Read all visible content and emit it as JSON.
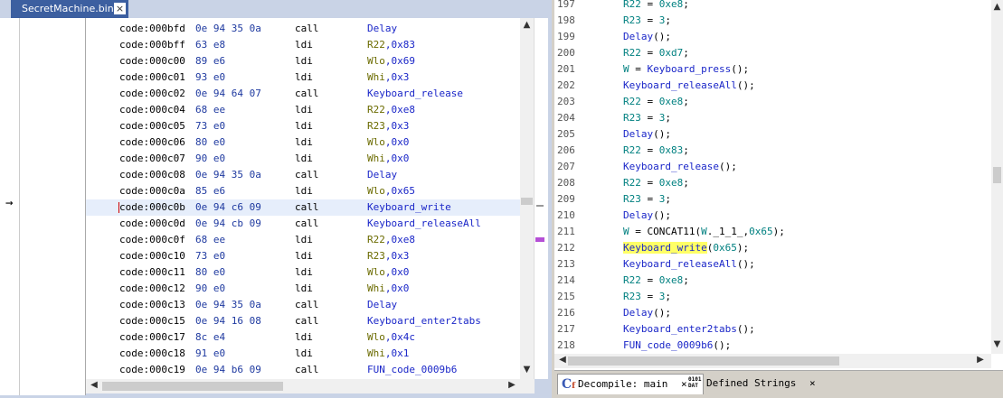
{
  "listing": {
    "tab_label": "SecretMachine.bin",
    "tab_close": "×",
    "arrow": "→",
    "rows": [
      {
        "addr": "code:000bfd",
        "bytes": "0e 94 35 0a",
        "mn": "call",
        "op": "Delay"
      },
      {
        "addr": "code:000bff",
        "bytes": "63 e8",
        "mn": "ldi",
        "op": "R22,0x83"
      },
      {
        "addr": "code:000c00",
        "bytes": "89 e6",
        "mn": "ldi",
        "op": "Wlo,0x69"
      },
      {
        "addr": "code:000c01",
        "bytes": "93 e0",
        "mn": "ldi",
        "op": "Whi,0x3"
      },
      {
        "addr": "code:000c02",
        "bytes": "0e 94 64 07",
        "mn": "call",
        "op": "Keyboard_release"
      },
      {
        "addr": "code:000c04",
        "bytes": "68 ee",
        "mn": "ldi",
        "op": "R22,0xe8"
      },
      {
        "addr": "code:000c05",
        "bytes": "73 e0",
        "mn": "ldi",
        "op": "R23,0x3"
      },
      {
        "addr": "code:000c06",
        "bytes": "80 e0",
        "mn": "ldi",
        "op": "Wlo,0x0"
      },
      {
        "addr": "code:000c07",
        "bytes": "90 e0",
        "mn": "ldi",
        "op": "Whi,0x0"
      },
      {
        "addr": "code:000c08",
        "bytes": "0e 94 35 0a",
        "mn": "call",
        "op": "Delay"
      },
      {
        "addr": "code:000c0a",
        "bytes": "85 e6",
        "mn": "ldi",
        "op": "Wlo,0x65"
      },
      {
        "addr": "code:000c0b",
        "bytes": "0e 94 c6 09",
        "mn": "call",
        "op": "Keyboard_write"
      },
      {
        "addr": "code:000c0d",
        "bytes": "0e 94 cb 09",
        "mn": "call",
        "op": "Keyboard_releaseAll"
      },
      {
        "addr": "code:000c0f",
        "bytes": "68 ee",
        "mn": "ldi",
        "op": "R22,0xe8"
      },
      {
        "addr": "code:000c10",
        "bytes": "73 e0",
        "mn": "ldi",
        "op": "R23,0x3"
      },
      {
        "addr": "code:000c11",
        "bytes": "80 e0",
        "mn": "ldi",
        "op": "Wlo,0x0"
      },
      {
        "addr": "code:000c12",
        "bytes": "90 e0",
        "mn": "ldi",
        "op": "Whi,0x0"
      },
      {
        "addr": "code:000c13",
        "bytes": "0e 94 35 0a",
        "mn": "call",
        "op": "Delay"
      },
      {
        "addr": "code:000c15",
        "bytes": "0e 94 16 08",
        "mn": "call",
        "op": "Keyboard_enter2tabs"
      },
      {
        "addr": "code:000c17",
        "bytes": "8c e4",
        "mn": "ldi",
        "op": "Wlo,0x4c"
      },
      {
        "addr": "code:000c18",
        "bytes": "91 e0",
        "mn": "ldi",
        "op": "Whi,0x1"
      },
      {
        "addr": "code:000c19",
        "bytes": "0e 94 b6 09",
        "mn": "call",
        "op": "FUN_code_0009b6"
      }
    ]
  },
  "decompile": {
    "lines": [
      {
        "n": "197",
        "t": "R22 = 0xe8;"
      },
      {
        "n": "198",
        "t": "R23 = 3;"
      },
      {
        "n": "199",
        "t": "Delay();"
      },
      {
        "n": "200",
        "t": "R22 = 0xd7;"
      },
      {
        "n": "201",
        "t": "W = Keyboard_press();"
      },
      {
        "n": "202",
        "t": "Keyboard_releaseAll();"
      },
      {
        "n": "203",
        "t": "R22 = 0xe8;"
      },
      {
        "n": "204",
        "t": "R23 = 3;"
      },
      {
        "n": "205",
        "t": "Delay();"
      },
      {
        "n": "206",
        "t": "R22 = 0x83;"
      },
      {
        "n": "207",
        "t": "Keyboard_release();"
      },
      {
        "n": "208",
        "t": "R22 = 0xe8;"
      },
      {
        "n": "209",
        "t": "R23 = 3;"
      },
      {
        "n": "210",
        "t": "Delay();"
      },
      {
        "n": "211",
        "t": "W = CONCAT11(W._1_1_,0x65);"
      },
      {
        "n": "212",
        "t": "Keyboard_write(0x65);"
      },
      {
        "n": "213",
        "t": "Keyboard_releaseAll();"
      },
      {
        "n": "214",
        "t": "R22 = 0xe8;"
      },
      {
        "n": "215",
        "t": "R23 = 3;"
      },
      {
        "n": "216",
        "t": "Delay();"
      },
      {
        "n": "217",
        "t": "Keyboard_enter2tabs();"
      },
      {
        "n": "218",
        "t": "FUN_code_0009b6();"
      }
    ]
  },
  "bottom_tabs": [
    {
      "label": "Decompile: main",
      "close": "×",
      "icon": "decompile-icon"
    },
    {
      "label": "Defined Strings",
      "close": "×",
      "icon": "strings-icon",
      "icon_text_top": "0101",
      "icon_text_bottom": "DAT"
    }
  ],
  "colors": {
    "tab_active": "#3c5fa0",
    "function": "#1a26c8",
    "variable": "#008080",
    "highlight": "#ffff66"
  }
}
